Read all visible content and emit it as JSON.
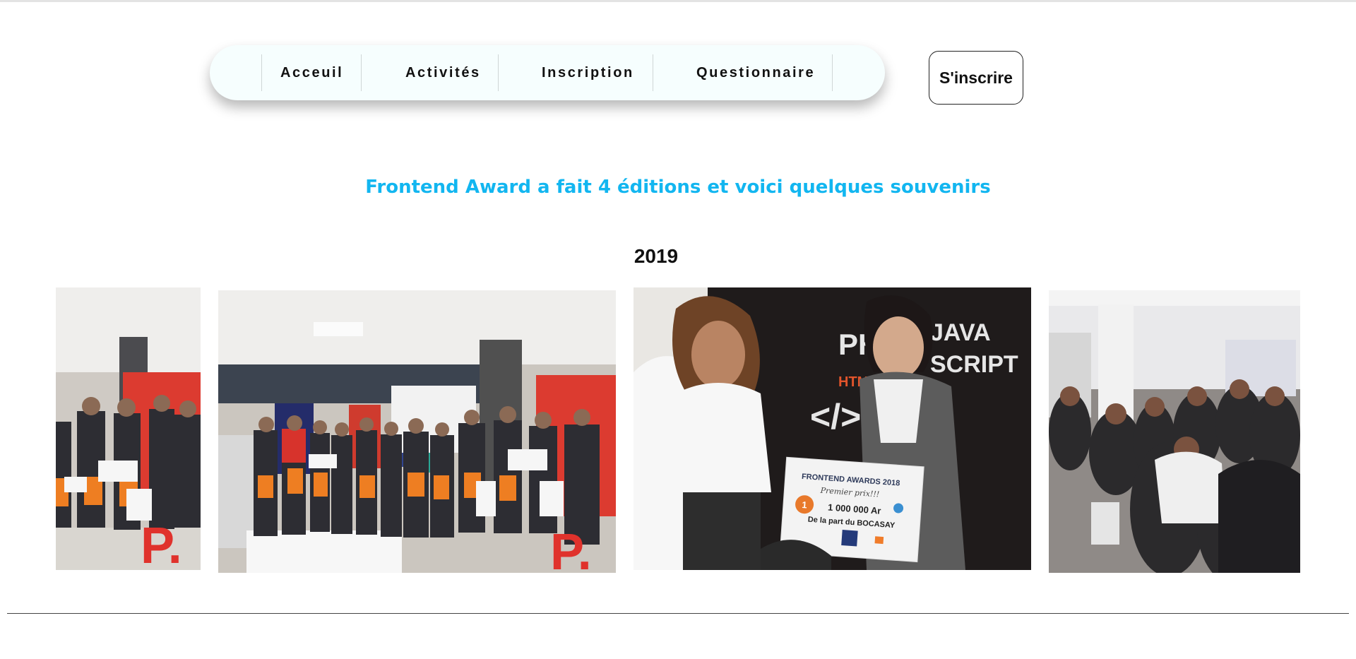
{
  "nav": {
    "links": [
      "Acceuil",
      "Activités",
      "Inscription",
      "Questionnaire"
    ],
    "cta_label": "S'inscrire"
  },
  "main": {
    "headline": "Frontend Award a fait 4 éditions et voici quelques souvenirs",
    "year": "2019",
    "photos": [
      {
        "alt": "Lauréats avec sacs (recadré)"
      },
      {
        "alt": "Groupe de lauréats avec sacs et chèques"
      },
      {
        "alt": "Remise du chèque Frontend Awards 2018"
      },
      {
        "alt": "Public assis dans la salle"
      }
    ],
    "certificate": {
      "title": "FRONTEND AWARDS 2018",
      "subtitle": "Premier prix!!!",
      "rank": "1",
      "amount": "1 000 000 Ar",
      "from": "De la part du BOCASAY"
    }
  },
  "colors": {
    "headline": "#12b6f0",
    "nav_bg": "#f6fefe"
  }
}
